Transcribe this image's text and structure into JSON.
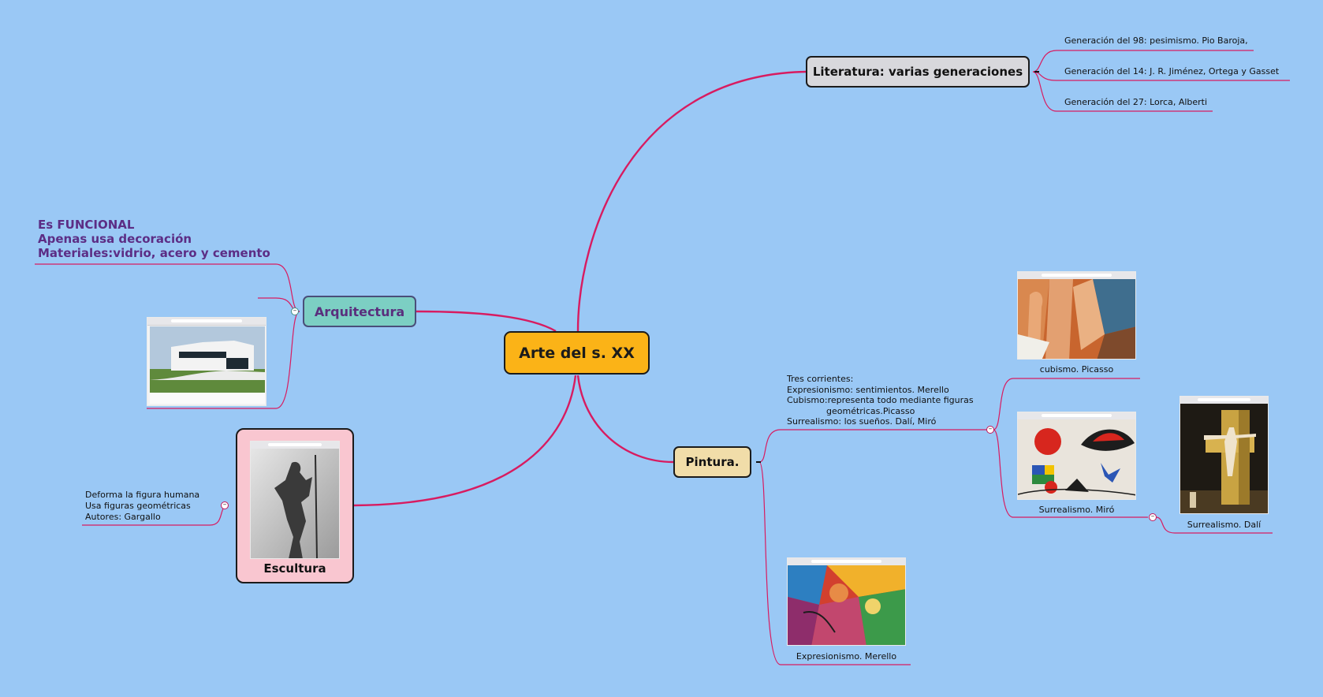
{
  "central": {
    "title": "Arte del s. XX"
  },
  "literatura": {
    "title": "Literatura: varias generaciones",
    "items": [
      "Generación del 98: pesimismo. Pio Baroja,",
      "Generación del 14: J. R. Jiménez, Ortega y Gasset",
      "Generación del 27: Lorca, Alberti"
    ]
  },
  "arquitectura": {
    "title": "Arquitectura",
    "notes": [
      "Es FUNCIONAL",
      "Apenas usa decoración",
      "Materiales:vidrio, acero y cemento"
    ],
    "image": "modern-white-house-photo"
  },
  "escultura": {
    "title": "Escultura",
    "notes": [
      "Deforma la figura humana",
      "Usa figuras geométricas",
      "Autores: Gargallo"
    ],
    "image": "sculpture-photo"
  },
  "pintura": {
    "title": "Pintura.",
    "notes": [
      "Tres corrientes:",
      "Expresionismo: sentimientos. Merello",
      "Cubismo:representa todo mediante figuras",
      "geométricas.Picasso",
      "Surrealismo: los sueños. Dalí, Miró"
    ],
    "captions": {
      "cubismo": "cubismo.    Picasso",
      "miro": "Surrealismo.    Miró",
      "dali": "Surrealismo.    Dalí",
      "expresionismo": "Expresionismo.  Merello"
    }
  },
  "colors": {
    "background": "#9ac8f5",
    "link": "#d81b60",
    "central": "#fbb317",
    "arquitectura": "#7ccfc3",
    "pintura": "#f1dda9",
    "escultura": "#f9c6d0",
    "literatura": "#d8d8dc",
    "note_text": "#5c2d85"
  }
}
